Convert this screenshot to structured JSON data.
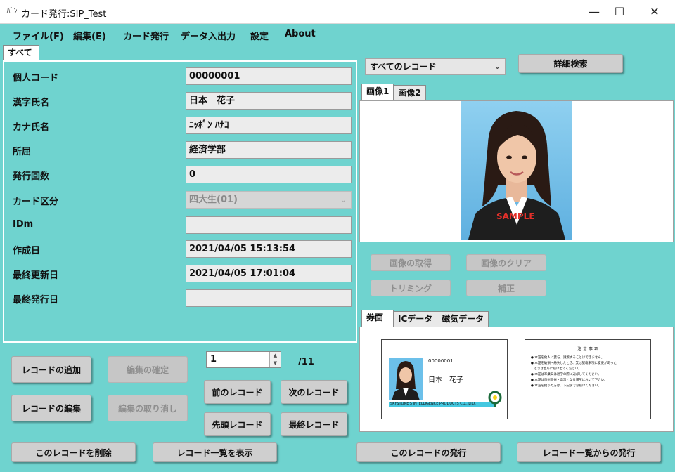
{
  "window": {
    "title": "カード発行:SIP_Test",
    "icon_text": "ﾊﾞﾝ",
    "minimize": "—",
    "maximize": "☐",
    "close": "✕"
  },
  "menu": [
    {
      "label": "ファイル(F)"
    },
    {
      "label": "編集(E)"
    },
    {
      "label": "カード発行"
    },
    {
      "label": "データ入出力"
    },
    {
      "label": "設定"
    },
    {
      "label": "About"
    }
  ],
  "left_tab": "すべて",
  "fields": [
    {
      "label": "個人コード",
      "value": "00000001"
    },
    {
      "label": "漢字氏名",
      "value": "日本　花子"
    },
    {
      "label": "カナ氏名",
      "value": "ﾆｯﾎﾟﾝ ﾊﾅｺ"
    },
    {
      "label": "所屈",
      "value": "経済学部"
    },
    {
      "label": "発行回数",
      "value": "0"
    },
    {
      "label": "カード区分",
      "value": "四大生(01)"
    },
    {
      "label": "IDm",
      "value": ""
    },
    {
      "label": "作成日",
      "value": "2021/04/05 15:13:54"
    },
    {
      "label": "最終更新日",
      "value": "2021/04/05 17:01:04"
    },
    {
      "label": "最終発行日",
      "value": ""
    }
  ],
  "buttons": {
    "add_record": "レコードの追加",
    "confirm_edit": "編集の確定",
    "edit_record": "レコードの編集",
    "cancel_edit": "編集の取り消し",
    "prev_record": "前のレコード",
    "next_record": "次のレコード",
    "first_record": "先頭レコード",
    "last_record": "最終レコード",
    "delete_record": "このレコードを削除",
    "show_list": "レコード一覧を表示",
    "issue_this": "このレコードの発行",
    "issue_from_list": "レコード一覧からの発行",
    "detail_search": "詳細検索",
    "get_image": "画像の取得",
    "clear_image": "画像のクリア",
    "trimming": "トリミング",
    "correction": "補正"
  },
  "pager": {
    "current": "1",
    "total": "/11"
  },
  "record_filter": {
    "selected": "すべてのレコード"
  },
  "image_tabs": [
    "画像1",
    "画像2"
  ],
  "card_tabs": [
    "券面",
    "ICデータ",
    "磁気データ"
  ],
  "photo": {
    "watermark": "SAMPLE"
  },
  "card_front": {
    "id": "00000001",
    "name": "日本　花子",
    "strip": "SKYSTONE'S INTELLIGENCE PRODUCTS CO., LTD."
  },
  "card_back": {
    "heading": "注 意 事 項",
    "lines": [
      "● 本証を他人に貸与、譲渡することはできません。",
      "● 本証を破損・紛失したとき、又は記載事項に変更があった",
      "　ときは直ちに届け出てください。",
      "● 本証は卒業又は退学の際に返却してください。",
      "● 本証は直射日光・高温となる場所において下さい。",
      "● 本証を拾った方は、下記までお届けください。"
    ]
  }
}
